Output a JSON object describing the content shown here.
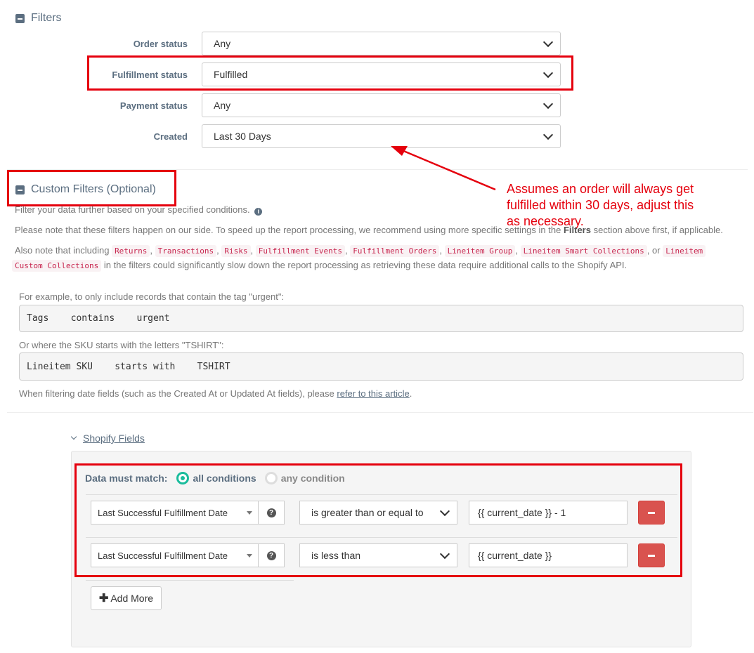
{
  "filters": {
    "title": "Filters",
    "rows": [
      {
        "label": "Order status",
        "value": "Any"
      },
      {
        "label": "Fulfillment status",
        "value": "Fulfilled"
      },
      {
        "label": "Payment status",
        "value": "Any"
      },
      {
        "label": "Created",
        "value": "Last 30 Days"
      }
    ]
  },
  "annotation": {
    "line1": "Assumes an order will always get",
    "line2": "fulfilled within 30 days, adjust this",
    "line3": "as necessary.",
    "color": "#e5000d"
  },
  "custom": {
    "title": "Custom Filters (Optional)",
    "subtitle": "Filter your data further based on your specified conditions.",
    "note1_a": "Please note that these filters happen on our side. To speed up the report processing, we recommend using more specific settings in the",
    "note1_b": "Filters",
    "note1_c": "section above first, if applicable.",
    "note2_a": "Also note that including",
    "codes": [
      "Returns",
      "Transactions",
      "Risks",
      "Fulfillment Events",
      "Fulfillment Orders",
      "Lineitem Group",
      "Lineitem Smart Collections"
    ],
    "or": ", or",
    "code_last_1": "Lineitem",
    "code_last_2": "Custom Collections",
    "note2_b": "in the filters could significantly slow down the report processing as retrieving these data require additional calls to the Shopify API.",
    "example1_caption": "For example, to only include records that contain the tag \"urgent\":",
    "example1_code": "Tags    contains    urgent",
    "example2_caption": "Or where the SKU starts with the letters \"TSHIRT\":",
    "example2_code": "Lineitem SKU    starts with    TSHIRT",
    "date_note_a": "When filtering date fields (such as the Created At or Updated At fields), please",
    "date_note_link": "refer to this article",
    "date_note_b": "."
  },
  "shopify": {
    "section_label": "Shopify Fields",
    "match_label": "Data must match:",
    "opt_all": "all conditions",
    "opt_any": "any condition",
    "conditions": [
      {
        "field": "Last Successful Fulfillment Date",
        "operator": "is greater than or equal to",
        "value": "{{ current_date }} - 1"
      },
      {
        "field": "Last Successful Fulfillment Date",
        "operator": "is less than",
        "value": "{{ current_date }}"
      }
    ],
    "add_more": "Add More"
  }
}
